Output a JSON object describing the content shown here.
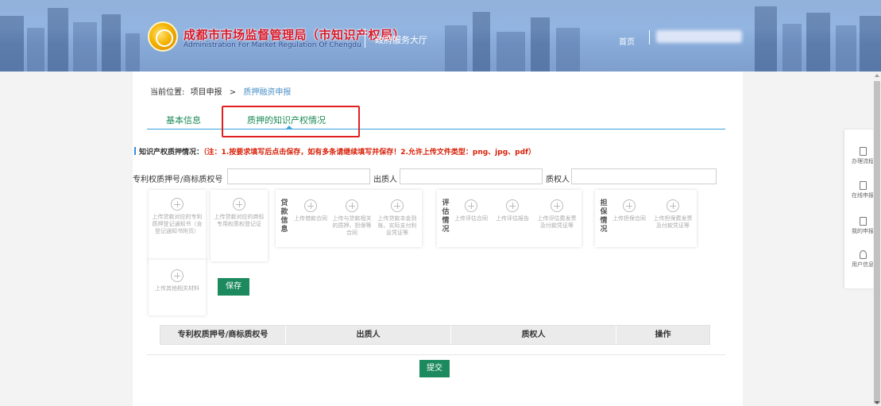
{
  "header": {
    "title": "成都市市场监督管理局（市知识产权局）",
    "subtitle": "Administration For Market Regulation Of Chengdu",
    "hall": "政府服务大厅",
    "home": "首页"
  },
  "breadcrumb": {
    "label": "当前位置:",
    "root": "项目申报",
    "separator": ">",
    "current": "质押融资申报"
  },
  "tabs": [
    {
      "label": "基本信息"
    },
    {
      "label": "质押的知识产权情况"
    }
  ],
  "note": {
    "label": "知识产权质押情况：",
    "text": "（注：1.按要求填写后点击保存，如有多条请继续填写并保存！2.允许上传文件类型：png、jpg、pdf）"
  },
  "form": {
    "patent_label": "专利权质押号/商标质权号",
    "pledgor_label": "出质人",
    "pledgee_label": "质权人",
    "patent_value": "",
    "pledgor_value": "",
    "pledgee_value": ""
  },
  "uploads": {
    "single": [
      "上传贷款对应的专利质押登记通知书（含登记通知书附页）",
      "上传贷款对应的商标专用权质权登记证"
    ],
    "groups": [
      {
        "label": "贷款信息",
        "items": [
          "上传借款合同",
          "上传与贷款相关的质押、担保等合同",
          "上传贷款本金到账、实际支付利息凭证等"
        ]
      },
      {
        "label": "评估情况",
        "items": [
          "上传评估合同",
          "上传评估报告",
          "上传评估费发票及付款凭证等"
        ]
      },
      {
        "label": "担保情况",
        "items": [
          "上传担保合同",
          "上传担保费发票及付款凭证等"
        ]
      }
    ],
    "other": "上传其他相关材料"
  },
  "buttons": {
    "save": "保存",
    "submit": "提交"
  },
  "table": {
    "columns": [
      "专利权质押号/商标质权号",
      "出质人",
      "质权人",
      "操作"
    ],
    "rows": []
  },
  "sidebar": {
    "items": [
      {
        "label": "办理流程",
        "icon": "document-icon"
      },
      {
        "label": "在线申报",
        "icon": "edit-document-icon"
      },
      {
        "label": "我的申报",
        "icon": "list-document-icon"
      },
      {
        "label": "用户信息",
        "icon": "user-icon"
      }
    ]
  },
  "colors": {
    "accent_green": "#1c8a5e",
    "tab_line_blue": "#3aa1dc",
    "highlight_red": "#e02020",
    "note_red": "#d81e06"
  }
}
